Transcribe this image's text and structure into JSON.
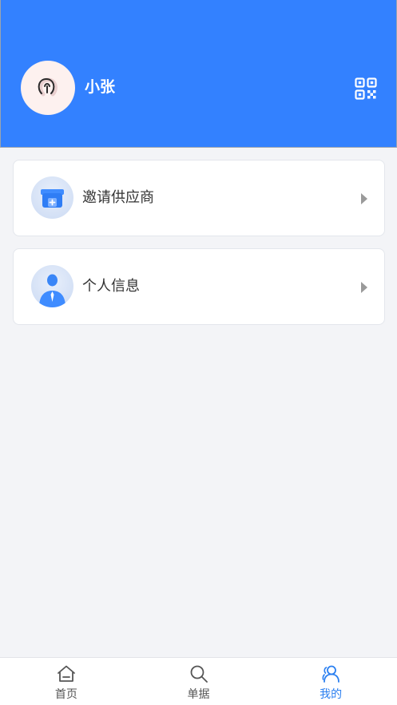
{
  "profile": {
    "username": "小张"
  },
  "menu": [
    {
      "label": "邀请供应商",
      "icon": "shop-plus-icon"
    },
    {
      "label": "个人信息",
      "icon": "person-tie-icon"
    }
  ],
  "tabs": [
    {
      "label": "首页",
      "icon": "home-icon",
      "active": false
    },
    {
      "label": "单据",
      "icon": "search-icon",
      "active": false
    },
    {
      "label": "我的",
      "icon": "user-group-icon",
      "active": true
    }
  ],
  "colors": {
    "header": "#3381ff",
    "accent": "#2a7ff0",
    "background": "#f3f4f7"
  }
}
